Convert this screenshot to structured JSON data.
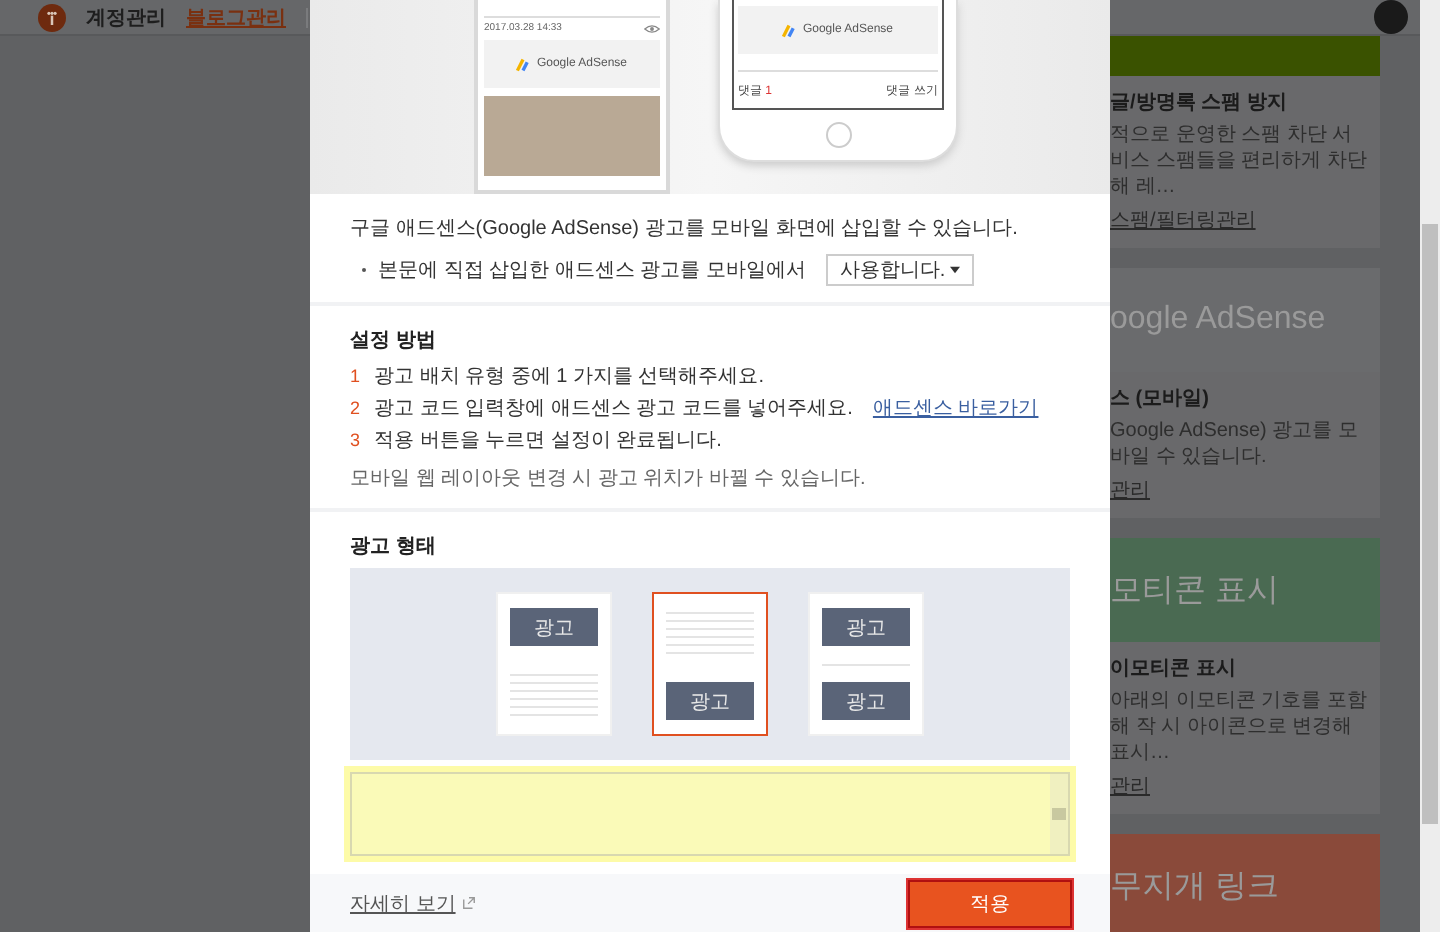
{
  "header": {
    "tabs": [
      {
        "label": "계정관리",
        "selected": false
      },
      {
        "label": "블로그관리",
        "selected": true
      }
    ]
  },
  "background_cards": [
    {
      "color": "#3a5200",
      "title": "글/방명록 스팸 방지",
      "description": "적으로 운영한 스팸 차단 서비스 스팸들을 편리하게 차단해 레…",
      "link": "스팸/필터링관리"
    },
    {
      "banner_text": "oogle AdSense",
      "color": "#6a6b6d",
      "title": "스 (모바일)",
      "description": "Google AdSense) 광고를 모바일 수 있습니다.",
      "link": "관리"
    },
    {
      "banner_text": "모티콘 표시",
      "color": "#4a6a52",
      "title": "이모티콘 표시",
      "description": "아래의 이모티콘 기호를 포함해 작 시 아이콘으로 변경해 표시…",
      "link": "관리"
    },
    {
      "banner_text": "무지개 링크",
      "color": "#8a4a3a"
    }
  ],
  "preview": {
    "phone_left": {
      "date": "2017.03.28 14:33",
      "ad_text": "Google AdSense"
    },
    "phone_right": {
      "ad_text": "Google AdSense",
      "comments": "댓글",
      "comment_count": "1",
      "write_comment": "댓글 쓰기"
    }
  },
  "intro": {
    "text": "구글 애드센스(Google AdSense) 광고를 모바일 화면에 삽입할 수 있습니다.",
    "option_label": "본문에 직접 삽입한 애드센스 광고를 모바일에서",
    "select_value": "사용합니다."
  },
  "setup": {
    "title": "설정 방법",
    "steps": [
      {
        "number": "1",
        "text": "광고 배치 유형 중에 1 가지를 선택해주세요."
      },
      {
        "number": "2",
        "text": "광고 코드 입력창에 애드센스 광고 코드를 넣어주세요.",
        "link": "애드센스 바로가기"
      },
      {
        "number": "3",
        "text": "적용 버튼을 누르면 설정이 완료됩니다."
      }
    ],
    "note": "모바일 웹 레이아웃 변경 시 광고 위치가 바뀔 수 있습니다."
  },
  "ad_format": {
    "title": "광고 형태",
    "layouts": [
      {
        "kind": "top",
        "ads": [
          "광고"
        ],
        "selected": false
      },
      {
        "kind": "bottom",
        "ads": [
          "광고"
        ],
        "selected": true
      },
      {
        "kind": "both",
        "ads": [
          "광고",
          "광고"
        ],
        "selected": false
      }
    ]
  },
  "footer": {
    "link": "자세히 보기",
    "button": "적용"
  }
}
